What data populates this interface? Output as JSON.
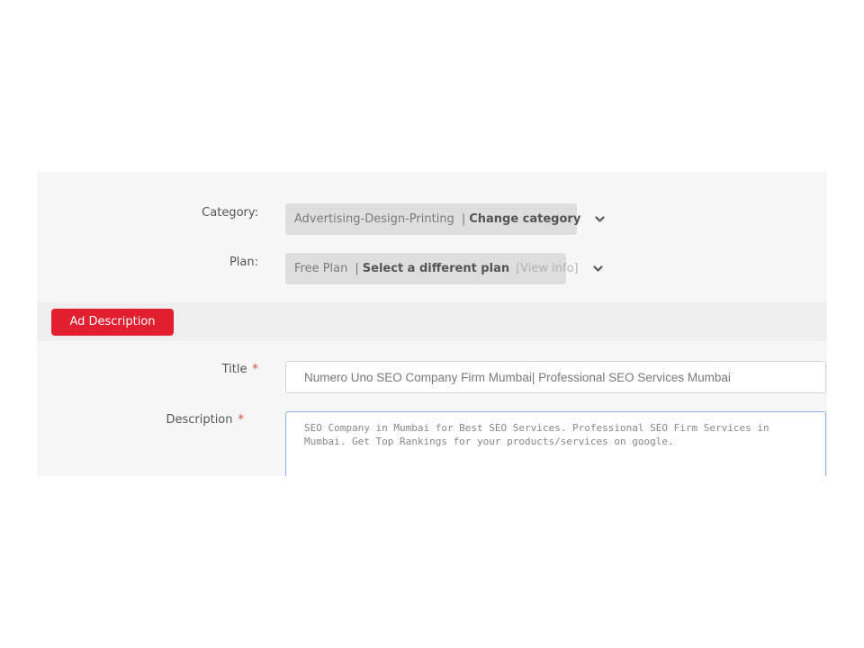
{
  "form": {
    "category": {
      "label": "Category:",
      "current": "Advertising-Design-Printing",
      "change_prefix": "|",
      "change_label": "Change category"
    },
    "plan": {
      "label": "Plan:",
      "current": "Free Plan",
      "change_prefix": "|",
      "change_label": "Select a different plan",
      "info_label": "[View info]"
    },
    "section": {
      "button_label": "Ad Description"
    },
    "title_field": {
      "label": "Title",
      "required_mark": "*",
      "value": "Numero Uno SEO Company Firm Mumbai| Professional SEO Services Mumbai"
    },
    "description_field": {
      "label": "Description",
      "required_mark": "*",
      "value": "SEO Company in Mumbai for Best SEO Services. Professional SEO Firm Services in Mumbai. Get Top Rankings for your products/services on google."
    }
  },
  "colors": {
    "accent_red": "#e31e2f",
    "required_asterisk": "#e8473f",
    "focus_border": "#8aaee6"
  },
  "icons": {
    "dropdown": "chevron-down-icon"
  }
}
